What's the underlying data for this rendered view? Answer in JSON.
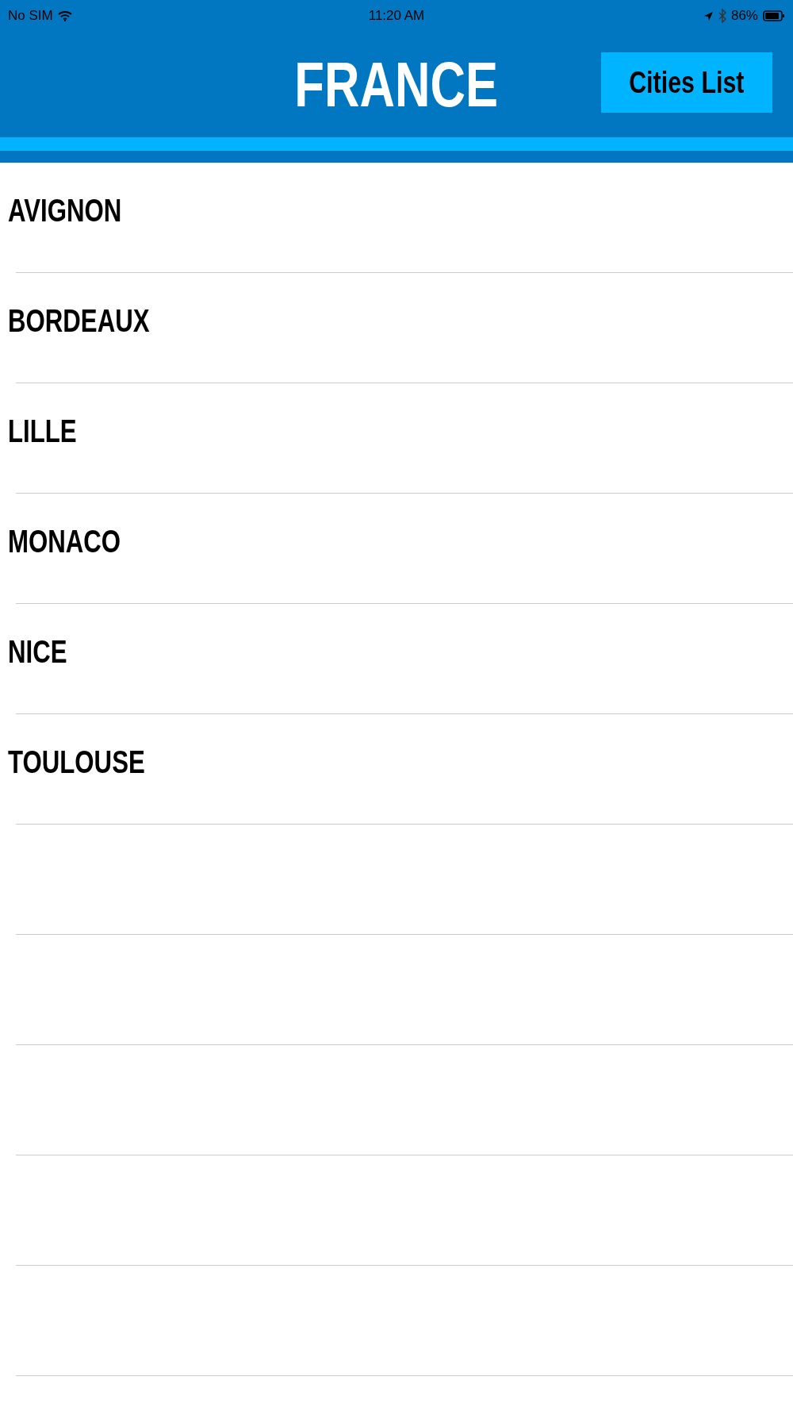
{
  "status_bar": {
    "carrier": "No SIM",
    "time": "11:20 AM",
    "battery": "86%"
  },
  "header": {
    "title": "FRANCE",
    "button": "Cities List"
  },
  "cities": [
    {
      "name": "AVIGNON"
    },
    {
      "name": "BORDEAUX"
    },
    {
      "name": "LILLE"
    },
    {
      "name": "MONACO"
    },
    {
      "name": "NICE"
    },
    {
      "name": "TOULOUSE"
    }
  ]
}
